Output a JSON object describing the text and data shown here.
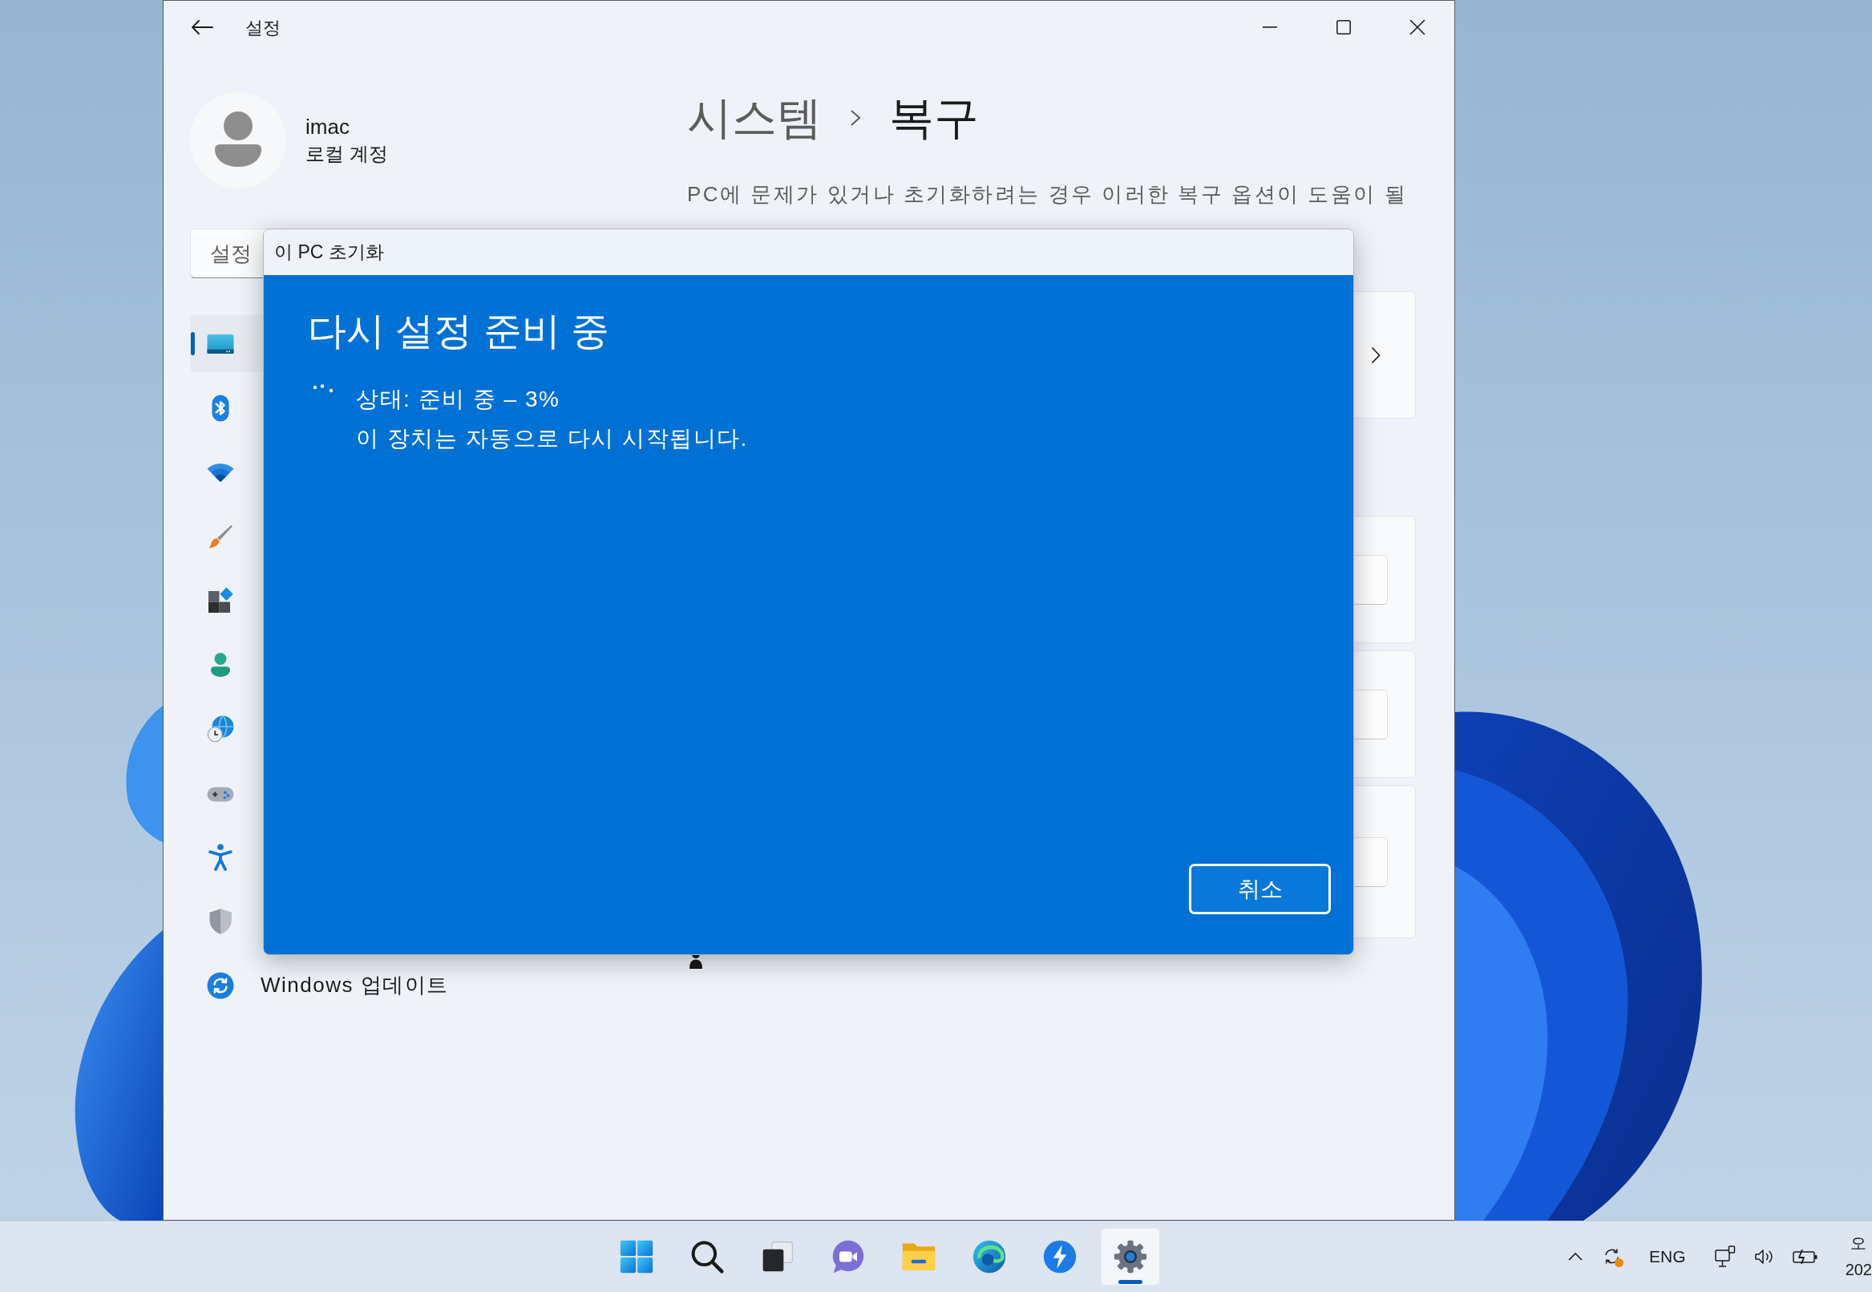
{
  "window": {
    "title": "설정"
  },
  "account": {
    "name": "imac",
    "type": "로컬 계정"
  },
  "search": {
    "placeholder": "설정"
  },
  "sidebar": {
    "items": [
      {
        "selected": true
      },
      {
        "selected": false
      },
      {
        "selected": false
      },
      {
        "selected": false
      },
      {
        "selected": false
      },
      {
        "selected": false
      },
      {
        "selected": false
      },
      {
        "selected": false
      },
      {
        "selected": false
      },
      {
        "selected": false
      },
      {
        "label": "Windows 업데이트",
        "selected": false
      }
    ]
  },
  "header": {
    "breadcrumb": [
      "시스템",
      "복구"
    ],
    "description": "PC에 문제가 있거나 초기화하려는 경우 이러한 복구 옵션이 도움이 될"
  },
  "sections": [
    {
      "cards": [
        {
          "kind": "link"
        }
      ]
    },
    {
      "cards": [
        {
          "kind": "button"
        },
        {
          "kind": "button"
        },
        {
          "kind": "button"
        }
      ]
    }
  ],
  "dialog": {
    "title": "이 PC 초기화",
    "heading": "다시 설정 준비 중",
    "status": "상태: 준비 중 – 3%",
    "message": "이 장치는 자동으로 다시 시작됩니다.",
    "cancel_button": "취소"
  },
  "taskbar": {
    "apps": [
      {
        "selected": false
      },
      {
        "selected": false
      },
      {
        "selected": false
      },
      {
        "selected": false
      },
      {
        "selected": false
      },
      {
        "selected": false
      },
      {
        "selected": false
      },
      {
        "selected": true
      }
    ]
  },
  "tray": {
    "language": "ENG",
    "clock": {
      "time": "오",
      "date": "202"
    }
  }
}
